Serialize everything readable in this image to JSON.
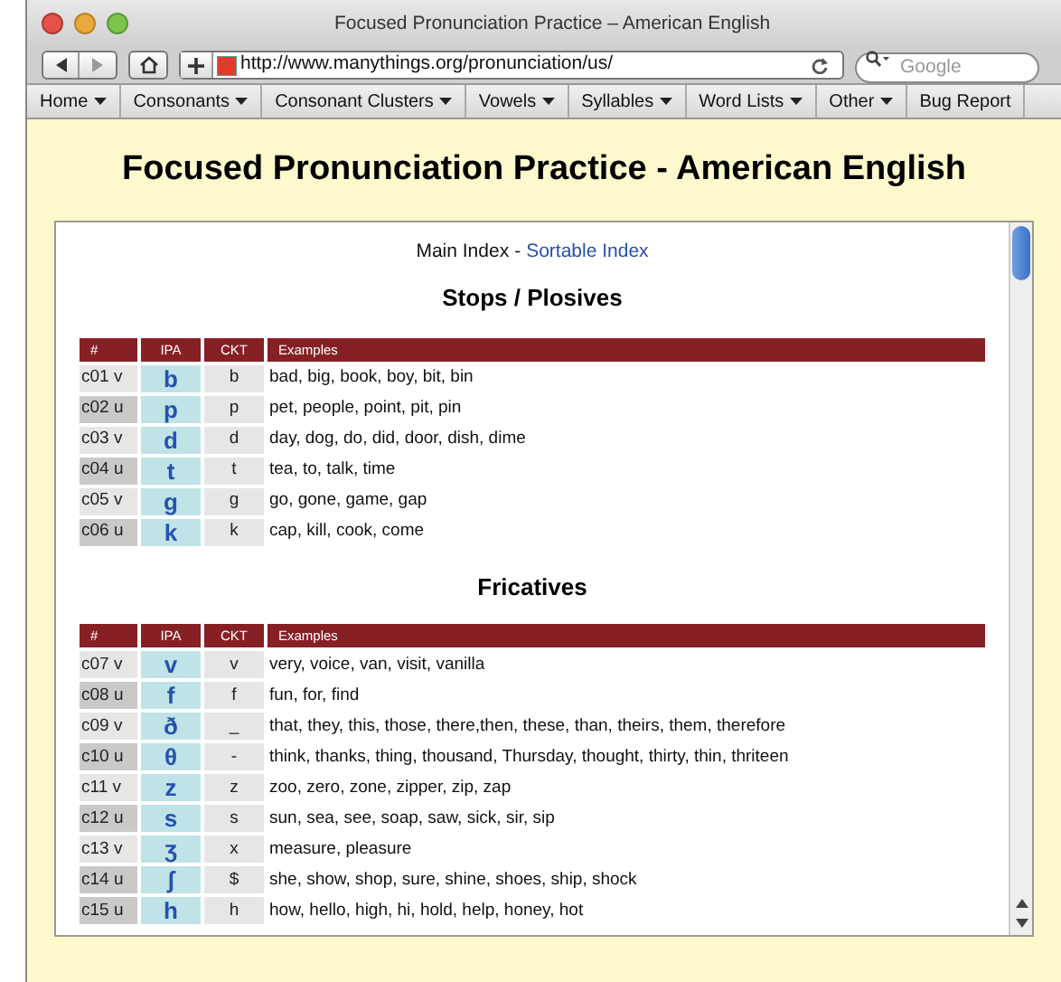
{
  "window": {
    "title": "Focused Pronunciation Practice – American English"
  },
  "toolbar": {
    "url": "http://www.manythings.org/pronunciation/us/",
    "search_placeholder": "Google"
  },
  "bookmarks": [
    {
      "label": "Home",
      "menu": true
    },
    {
      "label": "Consonants",
      "menu": true
    },
    {
      "label": "Consonant Clusters",
      "menu": true
    },
    {
      "label": "Vowels",
      "menu": true
    },
    {
      "label": "Syllables",
      "menu": true
    },
    {
      "label": "Word Lists",
      "menu": true
    },
    {
      "label": "Other",
      "menu": true
    },
    {
      "label": "Bug Report",
      "menu": false
    }
  ],
  "page": {
    "heading": "Focused Pronunciation Practice - American English",
    "index_nav": {
      "current": "Main Index",
      "separator": "-",
      "link": "Sortable Index"
    },
    "sections": [
      {
        "title": "Stops / Plosives",
        "columns": [
          "#",
          "IPA",
          "CKT",
          "Examples"
        ],
        "rows": [
          {
            "id": "c01 v",
            "voiced": true,
            "ipa": "b",
            "ckt": "b",
            "examples": "bad, big, book, boy, bit, bin"
          },
          {
            "id": "c02 u",
            "voiced": false,
            "ipa": "p",
            "ckt": "p",
            "examples": "pet, people, point, pit, pin"
          },
          {
            "id": "c03 v",
            "voiced": true,
            "ipa": "d",
            "ckt": "d",
            "examples": "day, dog, do, did, door, dish, dime"
          },
          {
            "id": "c04 u",
            "voiced": false,
            "ipa": "t",
            "ckt": "t",
            "examples": "tea, to, talk, time"
          },
          {
            "id": "c05 v",
            "voiced": true,
            "ipa": "g",
            "ckt": "g",
            "examples": "go, gone, game, gap"
          },
          {
            "id": "c06 u",
            "voiced": false,
            "ipa": "k",
            "ckt": "k",
            "examples": "cap, kill, cook, come"
          }
        ]
      },
      {
        "title": "Fricatives",
        "columns": [
          "#",
          "IPA",
          "CKT",
          "Examples"
        ],
        "rows": [
          {
            "id": "c07 v",
            "voiced": true,
            "ipa": "v",
            "ckt": "v",
            "examples": "very, voice, van, visit, vanilla"
          },
          {
            "id": "c08 u",
            "voiced": false,
            "ipa": "f",
            "ckt": "f",
            "examples": "fun, for, find"
          },
          {
            "id": "c09 v",
            "voiced": true,
            "ipa": "ð",
            "ckt": "_",
            "examples": "that, they, this, those, there,then, these, than, theirs, them, therefore"
          },
          {
            "id": "c10 u",
            "voiced": false,
            "ipa": "θ",
            "ckt": "-",
            "examples": "think, thanks, thing, thousand, Thursday, thought, thirty, thin, thriteen"
          },
          {
            "id": "c11 v",
            "voiced": true,
            "ipa": "z",
            "ckt": "z",
            "examples": "zoo, zero, zone, zipper, zip, zap"
          },
          {
            "id": "c12 u",
            "voiced": false,
            "ipa": "s",
            "ckt": "s",
            "examples": "sun, sea, see, soap, saw, sick, sir, sip"
          },
          {
            "id": "c13 v",
            "voiced": true,
            "ipa": "ʒ",
            "ckt": "x",
            "examples": "measure, pleasure"
          },
          {
            "id": "c14 u",
            "voiced": false,
            "ipa": "ʃ",
            "ckt": "$",
            "examples": "she, show, shop, sure, shine, shoes, ship, shock"
          },
          {
            "id": "c15 u",
            "voiced": false,
            "ipa": "h",
            "ckt": "h",
            "examples": "how, hello, high, hi, hold, help, honey, hot"
          }
        ]
      }
    ]
  }
}
